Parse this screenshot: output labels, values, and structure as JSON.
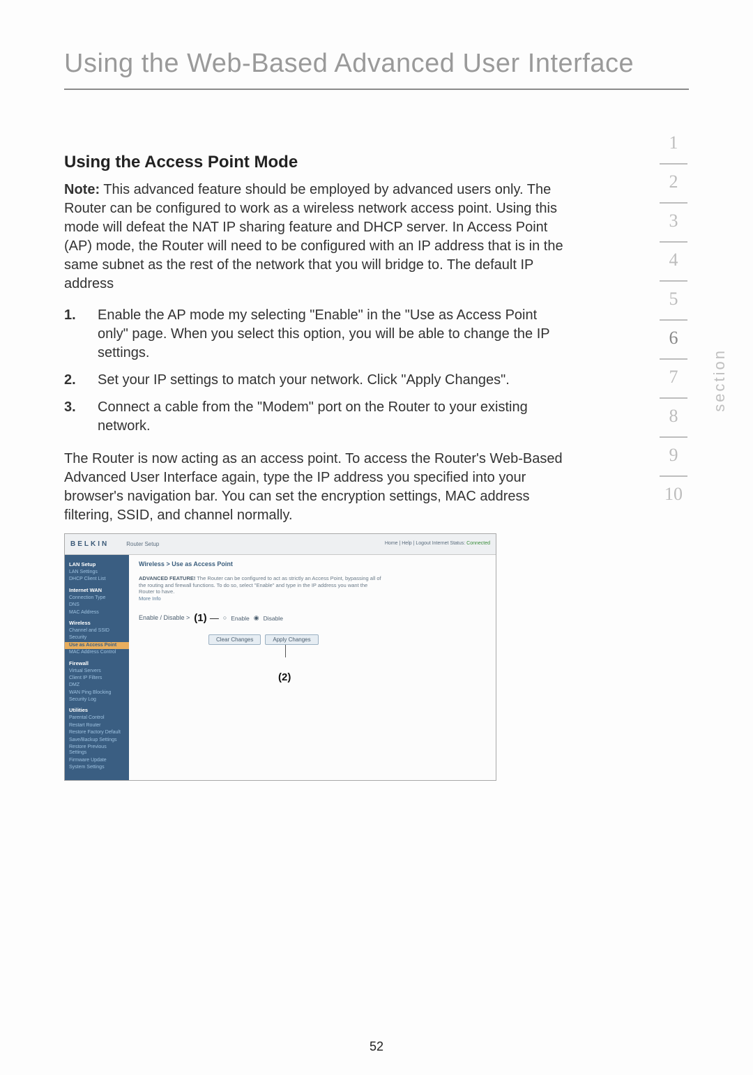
{
  "title": "Using the Web-Based Advanced User Interface",
  "subheading": "Using the Access Point Mode",
  "note_label": "Note:",
  "note_body": " This advanced feature should be employed by advanced users only. The Router can be configured to work as a wireless network access point. Using this mode will defeat the NAT IP sharing feature and DHCP server. In Access Point (AP) mode, the Router will need to be configured with an IP address that is in the same subnet as the rest of the network that you will bridge to. The default IP address",
  "steps": [
    {
      "num": "1.",
      "text": "Enable the AP mode my selecting \"Enable\" in the \"Use as Access Point only\" page. When you select this option, you will be able to change the IP settings."
    },
    {
      "num": "2.",
      "text": "Set your IP settings to match your network. Click \"Apply Changes\"."
    },
    {
      "num": "3.",
      "text": "Connect a cable from the \"Modem\" port on the Router to your existing network."
    }
  ],
  "conclusion": "The Router is now acting as an access point. To access the Router's Web-Based Advanced User Interface again, type the IP address you specified into your browser's navigation bar. You can set the encryption settings, MAC address filtering, SSID, and channel normally.",
  "section_label": "section",
  "section_numbers": [
    "1",
    "2",
    "3",
    "4",
    "5",
    "6",
    "7",
    "8",
    "9",
    "10"
  ],
  "active_section": "6",
  "page_number": "52",
  "screenshot": {
    "logo": "BELKIN",
    "header_title": "Router Setup",
    "header_right_1": "Home | Help | Logout   Internet Status:",
    "header_right_2": "Connected",
    "crumb": "Wireless > Use as Access Point",
    "advanced_label": "ADVANCED FEATURE!",
    "advanced_text": " The Router can be configured to act as strictly an Access Point, bypassing all of the routing and firewall functions. To do so, select \"Enable\" and type in the IP address you want the Router to have.",
    "more_link": "More Info",
    "enable_label": "Enable / Disable >",
    "marker1": "(1)",
    "dash": "—",
    "radio1": "Enable",
    "radio2": "Disable",
    "clear_btn": "Clear Changes",
    "apply_btn": "Apply Changes",
    "marker2": "(2)",
    "sidebar": {
      "grp1": "LAN Setup",
      "i1a": "LAN Settings",
      "i1b": "DHCP Client List",
      "grp2": "Internet WAN",
      "i2a": "Connection Type",
      "i2b": "DNS",
      "i2c": "MAC Address",
      "grp3": "Wireless",
      "i3a": "Channel and SSID",
      "i3b": "Security",
      "i3hl": "Use as Access Point",
      "i3c": "MAC Address Control",
      "grp4": "Firewall",
      "i4a": "Virtual Servers",
      "i4b": "Client IP Filters",
      "i4c": "DMZ",
      "i4d": "WAN Ping Blocking",
      "i4e": "Security Log",
      "grp5": "Utilities",
      "i5a": "Parental Control",
      "i5b": "Restart Router",
      "i5c": "Restore Factory Default",
      "i5d": "Save/Backup Settings",
      "i5e": "Restore Previous Settings",
      "i5f": "Firmware Update",
      "i5g": "System Settings"
    }
  }
}
